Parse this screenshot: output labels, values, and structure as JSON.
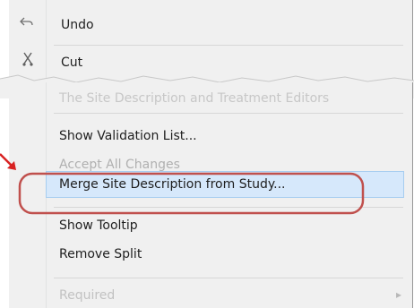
{
  "menu": {
    "top_items": [
      {
        "label": "Undo",
        "icon": "undo-icon"
      },
      {
        "label": "Cut",
        "icon": "scissors-icon"
      }
    ],
    "faded_heading": "The Site Description and Treatment Editors",
    "items": [
      {
        "label": "Show Validation List...",
        "state": "enabled"
      },
      {
        "label": "Accept All Changes",
        "state": "partially-hidden"
      },
      {
        "label": "Merge Site Description from Study...",
        "state": "highlighted"
      },
      {
        "label": "Show Tooltip",
        "state": "enabled"
      },
      {
        "label": "Remove Split",
        "state": "enabled"
      },
      {
        "label": "Required",
        "state": "disabled"
      }
    ]
  },
  "colors": {
    "menu_bg": "#f0f0f0",
    "highlight_bg": "#d6e8fb",
    "highlight_border": "#a7cdf0",
    "callout": "#c0504d",
    "arrow": "#d82222"
  }
}
